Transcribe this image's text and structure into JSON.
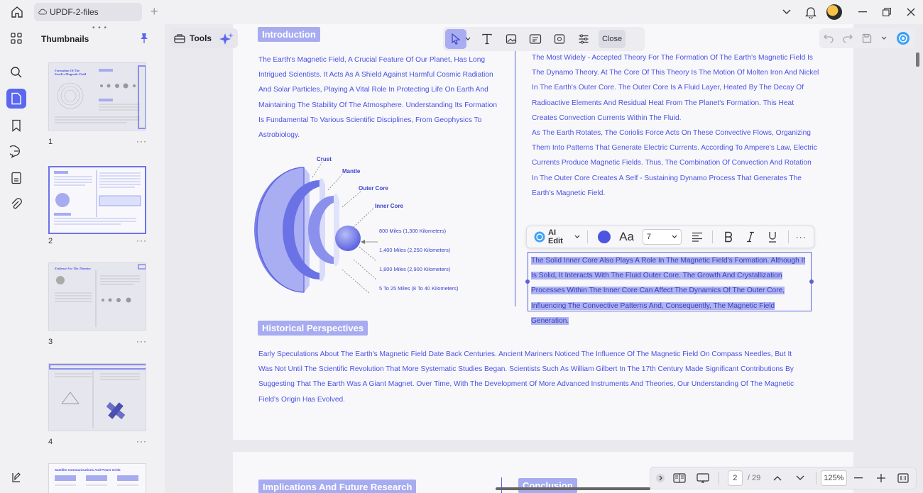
{
  "titlebar": {
    "file_tab": "UPDF-2-files",
    "add_tab_symbol": "+"
  },
  "thumbnails_panel": {
    "title": "Thumbnails",
    "pages": [
      {
        "num": "1",
        "title": "Formation Of The Earth's Magnetic Field"
      },
      {
        "num": "2",
        "title": ""
      },
      {
        "num": "3",
        "title": "Evidence For The Theories"
      },
      {
        "num": "4",
        "title": ""
      },
      {
        "num": "",
        "title": "Satellite Communications And Power Grids"
      }
    ],
    "more_symbol": "···"
  },
  "top_tools": {
    "tools_label": "Tools",
    "close_label": "Close"
  },
  "document": {
    "intro_heading": "Introduction",
    "intro_text": "The Earth's Magnetic Field, A Crucial Feature Of Our Planet, Has Long Intrigued Scientists. It Acts As A Shield Against Harmful Cosmic Radiation And Solar Particles, Playing A Vital Role In Protecting Life On Earth And Maintaining The Stability Of The Atmosphere. Understanding Its Formation Is Fundamental To Various Scientific Disciplines, From Geophysics To Astrobiology.",
    "right_text_1": "The Most Widely - Accepted Theory For The Formation Of The Earth's Magnetic Field Is The Dynamo Theory. At The Core Of This Theory Is The Motion Of Molten Iron And Nickel In The Earth's Outer Core. The Outer Core Is A Fluid Layer, Heated By The Decay Of Radioactive Elements And Residual Heat From The Planet's Formation. This Heat Creates Convection Currents Within The Fluid.",
    "right_text_2": "As The Earth Rotates, The Coriolis Force Acts On These Convective Flows, Organizing Them Into Patterns That Generate Electric Currents. According To Ampere's Law, Electric Currents Produce Magnetic Fields. Thus, The Combination Of Convection And Rotation In The Outer Core Creates A Self - Sustaining Dynamo Process That Generates The Earth's Magnetic Field.",
    "selected_text": "The Solid Inner Core Also Plays A Role In The Magnetic Field's Formation. Although It Is Solid, It Interacts With The Fluid Outer Core. The Growth And Crystallization Processes Within The Inner Core Can Affect The Dynamics Of The Outer Core, Influencing The Convective Patterns And, Consequently, The Magnetic Field Generation.",
    "historical_heading": "Historical Perspectives",
    "historical_text": "Early Speculations About The Earth's Magnetic Field Date Back Centuries. Ancient Mariners Noticed The Influence Of The Magnetic Field On Compass Needles, But It Was Not Until The Scientific Revolution That More Systematic Studies Began. Scientists Such As William Gilbert In The 17th Century Made Significant Contributions By Suggesting That The Earth Was A Giant Magnet. Over Time, With The Development Of More Advanced Instruments And Theories, Our Understanding Of The Magnetic Field's Origin Has Evolved.",
    "next_heading_left": "Implications And Future Research",
    "next_heading_right": "Conclusion",
    "diagram": {
      "crust": "Crust",
      "mantle": "Mantle",
      "outer_core": "Outer Core",
      "inner_core": "Inner Core",
      "d1": "800 Miles (1,300 Kilometers)",
      "d2": "1,400 Miles (2,250 Kilometers)",
      "d3": "1,800 Miles (2,900 Kilometers)",
      "d4": "5 To 25 Miles (8 To 40 Kilometers)"
    }
  },
  "format_toolbar": {
    "ai_edit": "AI Edit",
    "font_size": "7",
    "text_color": "#4c54e0",
    "font_label": "Aa"
  },
  "bottom_nav": {
    "page_current": "2",
    "page_total": "/ 29",
    "zoom": "125%"
  },
  "colors": {
    "accent": "#5b67f0",
    "text_blue": "#4a52e0",
    "tag_bg": "#a7acf0"
  }
}
